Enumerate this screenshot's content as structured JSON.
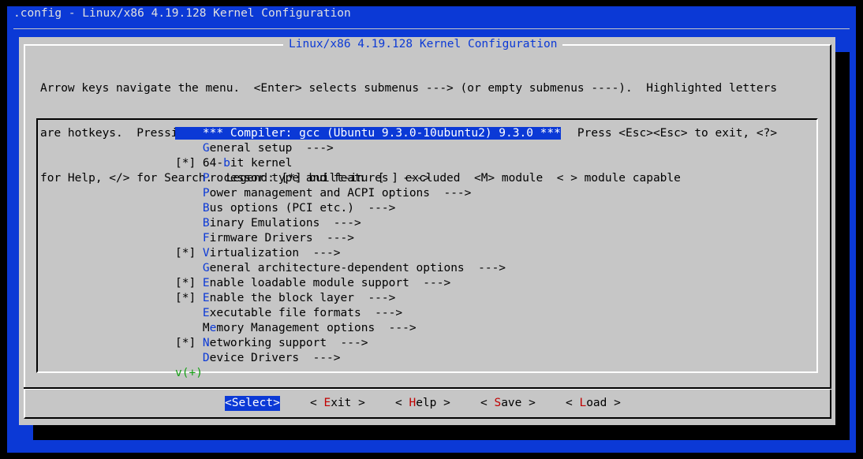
{
  "window": {
    "title": ".config - Linux/x86 4.19.128 Kernel Configuration"
  },
  "dialog": {
    "title": "Linux/x86 4.19.128 Kernel Configuration",
    "help_lines": [
      "Arrow keys navigate the menu.  <Enter> selects submenus ---> (or empty submenus ----).  Highlighted letters",
      "are hotkeys.  Pressing <Y> includes, <N> excludes, <M> modularizes features.  Press <Esc><Esc> to exit, <?>",
      "for Help, </> for Search.  Legend: [*] built-in  [ ] excluded  <M> module  < > module capable"
    ]
  },
  "menu": {
    "items": [
      {
        "prefix": "    ",
        "hotkey": "",
        "rest": "*** Compiler: gcc (Ubuntu 9.3.0-10ubuntu2) 9.3.0 ***",
        "selected": true
      },
      {
        "prefix": "    ",
        "hotkey": "G",
        "rest": "eneral setup  --->"
      },
      {
        "prefix": "[*] ",
        "pre": "64-",
        "hotkey": "b",
        "rest": "it kernel"
      },
      {
        "prefix": "    ",
        "hotkey": "P",
        "rest": "rocessor type and features  --->"
      },
      {
        "prefix": "    ",
        "hotkey": "P",
        "rest": "ower management and ACPI options  --->"
      },
      {
        "prefix": "    ",
        "hotkey": "B",
        "rest": "us options (PCI etc.)  --->"
      },
      {
        "prefix": "    ",
        "hotkey": "B",
        "rest": "inary Emulations  --->"
      },
      {
        "prefix": "    ",
        "hotkey": "F",
        "rest": "irmware Drivers  --->"
      },
      {
        "prefix": "[*] ",
        "hotkey": "V",
        "rest": "irtualization  --->"
      },
      {
        "prefix": "    ",
        "hotkey": "G",
        "rest": "eneral architecture-dependent options  --->"
      },
      {
        "prefix": "[*] ",
        "hotkey": "E",
        "rest": "nable loadable module support  --->"
      },
      {
        "prefix": "[*] ",
        "hotkey": "E",
        "rest": "nable the block layer  --->"
      },
      {
        "prefix": "    ",
        "hotkey": "E",
        "rest": "xecutable file formats  --->"
      },
      {
        "prefix": "    ",
        "pre": "M",
        "hotkey": "e",
        "rest": "mory Management options  --->"
      },
      {
        "prefix": "[*] ",
        "hotkey": "N",
        "rest": "etworking support  --->"
      },
      {
        "prefix": "    ",
        "hotkey": "D",
        "rest": "evice Drivers  --->"
      }
    ],
    "more_indicator": "v(+)"
  },
  "buttons": {
    "select": "<Select>",
    "exit": {
      "open": "< ",
      "hotkey": "E",
      "rest": "xit",
      "close": " >"
    },
    "help": {
      "open": "< ",
      "hotkey": "H",
      "rest": "elp",
      "close": " >"
    },
    "save": {
      "open": "< ",
      "hotkey": "S",
      "rest": "ave",
      "close": " >"
    },
    "load": {
      "open": "< ",
      "hotkey": "L",
      "rest": "oad",
      "close": " >"
    }
  },
  "colors": {
    "terminal_blue": "#0b39d6",
    "dialog_gray": "#c6c6c6",
    "hotkey_blue": "#0b39d6",
    "button_hotkey_red": "#c00000",
    "more_green": "#14a014"
  }
}
